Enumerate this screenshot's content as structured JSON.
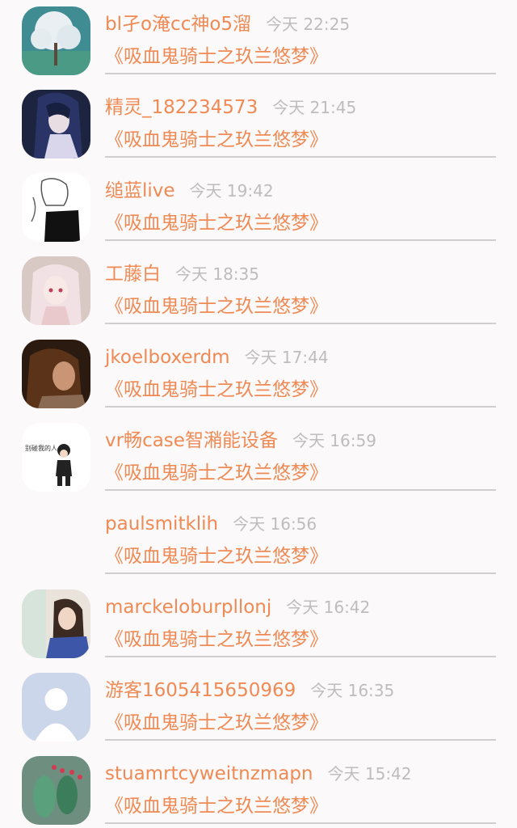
{
  "comments": [
    {
      "user": "bl孑o淹cc神o5溜",
      "time": "今天 22:25",
      "work": "《吸血鬼骑士之玖兰悠梦》",
      "avatar": "tree-avatar-icon"
    },
    {
      "user": "精灵_182234573",
      "time": "今天 21:45",
      "work": "《吸血鬼骑士之玖兰悠梦》",
      "avatar": "anime-girl-dark-avatar-icon"
    },
    {
      "user": "缒蓝live",
      "time": "今天 19:42",
      "work": "《吸血鬼骑士之玖兰悠梦》",
      "avatar": "sketch-girl-avatar-icon"
    },
    {
      "user": "工藤白",
      "time": "今天 18:35",
      "work": "《吸血鬼骑士之玖兰悠梦》",
      "avatar": "anime-girl-pink-avatar-icon"
    },
    {
      "user": "jkoelboxerdm",
      "time": "今天 17:44",
      "work": "《吸血鬼骑士之玖兰悠梦》",
      "avatar": "portrait-dark-avatar-icon"
    },
    {
      "user": "vr畅case智潲能设备",
      "time": "今天 16:59",
      "work": "《吸血鬼骑士之玖兰悠梦》",
      "avatar": "cartoon-boy-avatar-icon",
      "avatar_text": "别碰我的人"
    },
    {
      "user": "paulsmitklih",
      "time": "今天 16:56",
      "work": "《吸血鬼骑士之玖兰悠梦》",
      "avatar": "blank-avatar-icon"
    },
    {
      "user": "marckeloburpllonj",
      "time": "今天 16:42",
      "work": "《吸血鬼骑士之玖兰悠梦》",
      "avatar": "girl-window-avatar-icon"
    },
    {
      "user": "游客1605415650969",
      "time": "今天 16:35",
      "work": "《吸血鬼骑士之玖兰悠梦》",
      "avatar": "default-user-avatar-icon"
    },
    {
      "user": "stuamrtcyweitnzmapn",
      "time": "今天 15:42",
      "work": "《吸血鬼骑士之玖兰悠梦》",
      "avatar": "cactus-avatar-icon"
    }
  ]
}
